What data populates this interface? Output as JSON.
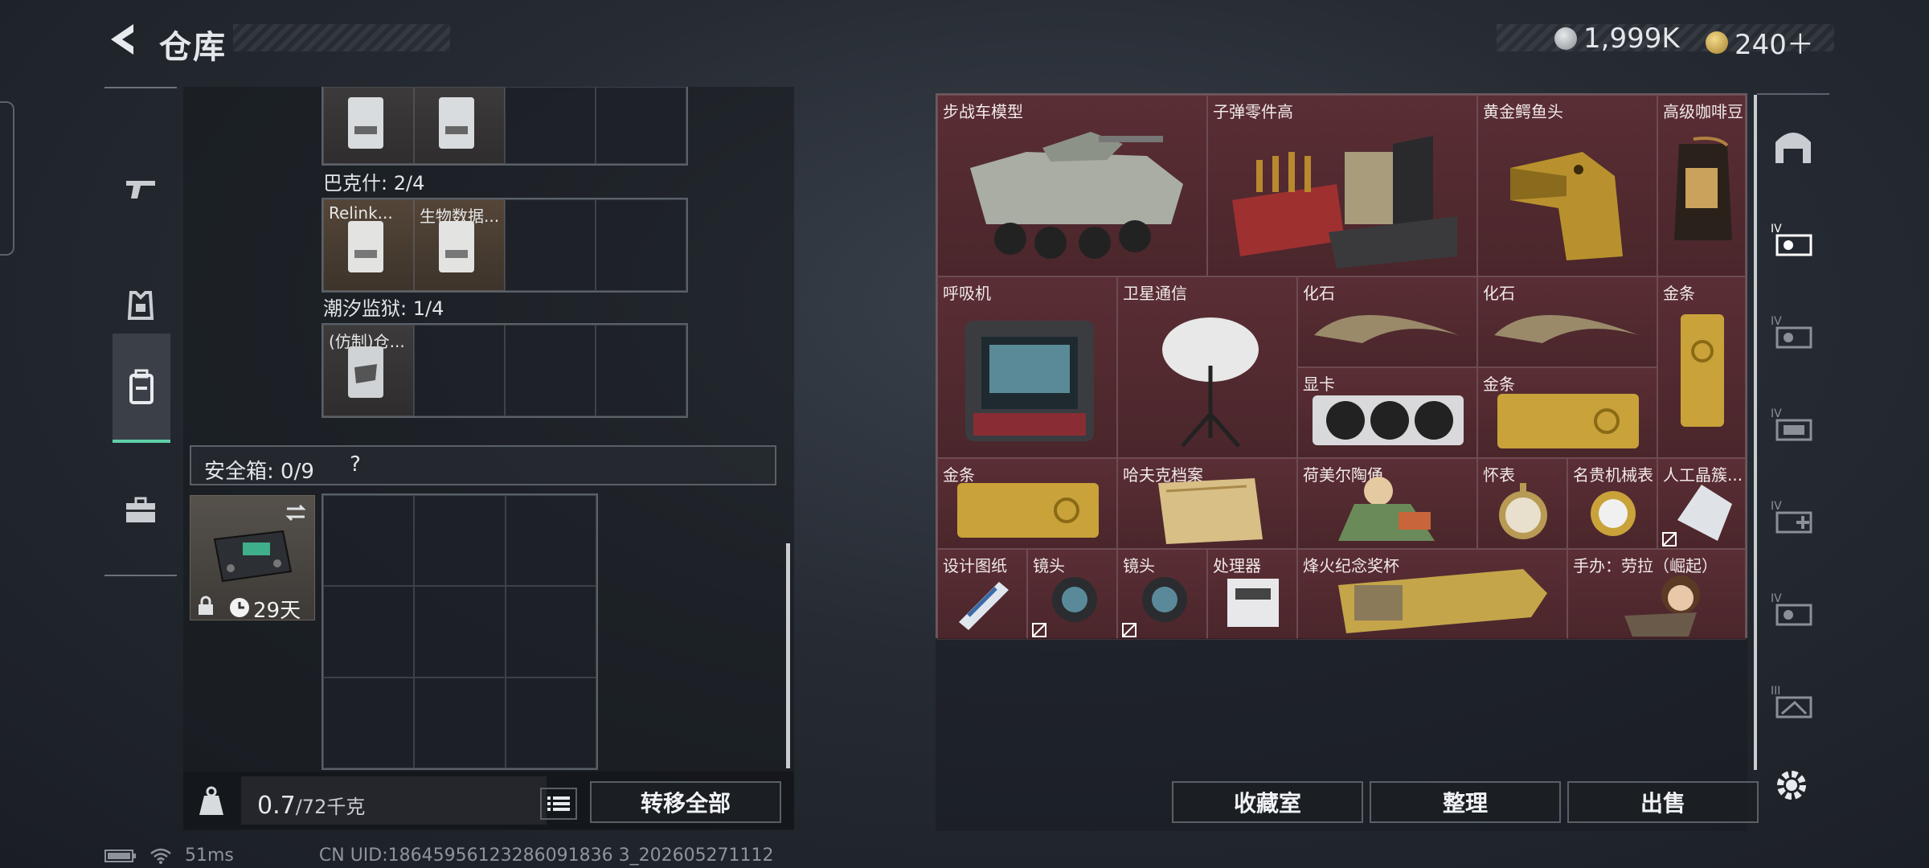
{
  "header": {
    "title": "仓库",
    "silver_amount": "1,999K",
    "gold_amount": "240＋"
  },
  "backpack": {
    "groups": [
      {
        "label": ""
      },
      {
        "label": "巴克什: 2/4",
        "items": [
          "Relink...",
          "生物数据..."
        ]
      },
      {
        "label": "潮汐监狱: 1/4",
        "items": [
          "(仿制)仓..."
        ]
      }
    ],
    "safebox_label": "安全箱: 0/9",
    "safebox_help": "?",
    "case_days": "29天",
    "weight_value": "0.7",
    "weight_max": "/72千克",
    "transfer_all": "转移全部"
  },
  "warehouse": {
    "items": [
      {
        "name": "步战车模型"
      },
      {
        "name": "子弹零件高"
      },
      {
        "name": "黄金鳄鱼头"
      },
      {
        "name": "高级咖啡豆"
      },
      {
        "name": "呼吸机"
      },
      {
        "name": "卫星通信"
      },
      {
        "name": "化石"
      },
      {
        "name": "化石"
      },
      {
        "name": "金条"
      },
      {
        "name": "显卡"
      },
      {
        "name": "金条"
      },
      {
        "name": "金条"
      },
      {
        "name": "哈夫克档案"
      },
      {
        "name": "荷美尔陶俑"
      },
      {
        "name": "怀表"
      },
      {
        "name": "名贵机械表"
      },
      {
        "name": "人工晶簇..."
      },
      {
        "name": "设计图纸"
      },
      {
        "name": "镜头"
      },
      {
        "name": "镜头"
      },
      {
        "name": "处理器"
      },
      {
        "name": "烽火纪念奖杯"
      },
      {
        "name": "手办：劳拉（崛起）"
      }
    ],
    "buttons": {
      "collection": "收藏室",
      "sort": "整理",
      "sell": "出售"
    }
  },
  "status": {
    "ping": "51ms",
    "uid": "CN UID:18645956123286091836 3_202605271112"
  },
  "colors": {
    "accent": "#5fd0a8",
    "warehouse_cell": "#5a2e34"
  }
}
